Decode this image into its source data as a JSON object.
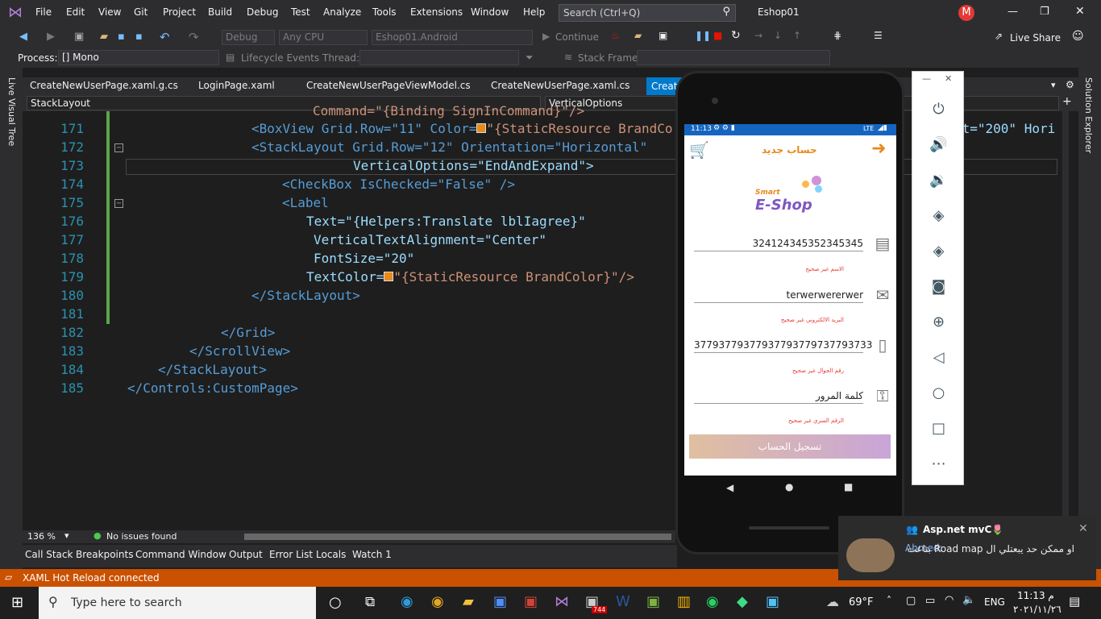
{
  "menu": {
    "items": [
      "File",
      "Edit",
      "View",
      "Git",
      "Project",
      "Build",
      "Debug",
      "Test",
      "Analyze",
      "Tools",
      "Extensions",
      "Window",
      "Help"
    ],
    "search_placeholder": "Search (Ctrl+Q)",
    "solution": "Eshop01",
    "avatar": "M"
  },
  "toolbar": {
    "config": "Debug",
    "platform": "Any CPU",
    "project": "Eshop01.Android",
    "continue": "Continue",
    "live_share": "Live Share"
  },
  "toolbar2": {
    "process_label": "Process:",
    "process_value": "[] Mono",
    "lifecycle": "Lifecycle Events",
    "thread_label": "Thread:",
    "stackframe_label": "Stack Frame:"
  },
  "left_strip": "Live Visual Tree",
  "right_strip": "Solution Explorer",
  "tabs": [
    "CreateNewUserPage.xaml.g.cs",
    "LoginPage.xaml",
    "CreateNewUserPageViewModel.cs",
    "CreateNewUserPage.xaml.cs",
    "Create"
  ],
  "nav": {
    "left": "StackLayout",
    "right": "VerticalOptions"
  },
  "code": {
    "line_numbers": [
      "171",
      "172",
      "173",
      "174",
      "175",
      "176",
      "177",
      "178",
      "179",
      "180",
      "181",
      "182",
      "183",
      "184",
      "185"
    ],
    "l0": "Command=\"{Binding SignInCommand}\"/>",
    "l171a": "<BoxView Grid.Row=\"11\" Color=",
    "l171b": "\"{StaticResource BrandCo",
    "l171c": "st=\"200\" Hori",
    "l172": "<StackLayout Grid.Row=\"12\" Orientation=\"Horizontal\"",
    "l173": "VerticalOptions=\"EndAndExpand\">",
    "l174": "<CheckBox IsChecked=\"False\" />",
    "l175": "<Label",
    "l176": "Text=\"{Helpers:Translate lblIagree}\"",
    "l177": "VerticalTextAlignment=\"Center\"",
    "l178": "FontSize=\"20\"",
    "l179a": "TextColor=",
    "l179b": "\"{StaticResource BrandColor}\"/>",
    "l180": "</StackLayout>",
    "l182": "</Grid>",
    "l183": "</ScrollView>",
    "l184": "</StackLayout>",
    "l185": "</Controls:CustomPage>"
  },
  "editor_status": {
    "zoom": "136 %",
    "issues": "No issues found"
  },
  "bottom_tabs": [
    "Call Stack",
    "Breakpoints",
    "Command Window",
    "Output",
    "Error List",
    "Locals",
    "Watch 1"
  ],
  "hot_reload": "XAML Hot Reload connected",
  "phone": {
    "time": "11:13",
    "network": "LTE",
    "title": "حساب جديد",
    "logo_top": "Smart",
    "logo_main": "E-Shop",
    "id_value": "324124345352345345",
    "id_error": "الاسم غير صحيح",
    "email_value": "terwerwererwer",
    "email_error": "البريد الالكتروني غير صحيح",
    "phone_value": "37793779377937793779737793733",
    "phone_error": "رقم الجوال غير صحيح",
    "password_placeholder": "كلمة المرور",
    "password_error": "الرقم السري غير صحيح",
    "register_button": "تسجيل الحساب"
  },
  "notification": {
    "group": "Asp.net mvC🌷",
    "sender": "Ahmed:",
    "message": "او ممكن حد يبعتلي ال Road map بتاعت"
  },
  "taskbar": {
    "search_placeholder": "Type here to search",
    "temperature": "69°F",
    "language": "ENG",
    "time": "11:13 م",
    "date": "٢٠٢١/١١/٢٦",
    "badge": "744"
  },
  "colors": {
    "accent": "#007acc",
    "hotreload": "#ca5100",
    "brand": "#e8891a"
  }
}
